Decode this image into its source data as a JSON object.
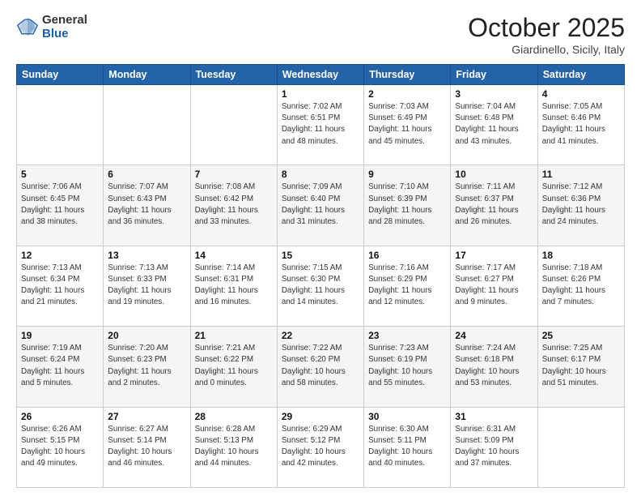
{
  "header": {
    "logo_general": "General",
    "logo_blue": "Blue",
    "month": "October 2025",
    "location": "Giardinello, Sicily, Italy"
  },
  "days_of_week": [
    "Sunday",
    "Monday",
    "Tuesday",
    "Wednesday",
    "Thursday",
    "Friday",
    "Saturday"
  ],
  "weeks": [
    [
      {
        "num": "",
        "info": ""
      },
      {
        "num": "",
        "info": ""
      },
      {
        "num": "",
        "info": ""
      },
      {
        "num": "1",
        "info": "Sunrise: 7:02 AM\nSunset: 6:51 PM\nDaylight: 11 hours\nand 48 minutes."
      },
      {
        "num": "2",
        "info": "Sunrise: 7:03 AM\nSunset: 6:49 PM\nDaylight: 11 hours\nand 45 minutes."
      },
      {
        "num": "3",
        "info": "Sunrise: 7:04 AM\nSunset: 6:48 PM\nDaylight: 11 hours\nand 43 minutes."
      },
      {
        "num": "4",
        "info": "Sunrise: 7:05 AM\nSunset: 6:46 PM\nDaylight: 11 hours\nand 41 minutes."
      }
    ],
    [
      {
        "num": "5",
        "info": "Sunrise: 7:06 AM\nSunset: 6:45 PM\nDaylight: 11 hours\nand 38 minutes."
      },
      {
        "num": "6",
        "info": "Sunrise: 7:07 AM\nSunset: 6:43 PM\nDaylight: 11 hours\nand 36 minutes."
      },
      {
        "num": "7",
        "info": "Sunrise: 7:08 AM\nSunset: 6:42 PM\nDaylight: 11 hours\nand 33 minutes."
      },
      {
        "num": "8",
        "info": "Sunrise: 7:09 AM\nSunset: 6:40 PM\nDaylight: 11 hours\nand 31 minutes."
      },
      {
        "num": "9",
        "info": "Sunrise: 7:10 AM\nSunset: 6:39 PM\nDaylight: 11 hours\nand 28 minutes."
      },
      {
        "num": "10",
        "info": "Sunrise: 7:11 AM\nSunset: 6:37 PM\nDaylight: 11 hours\nand 26 minutes."
      },
      {
        "num": "11",
        "info": "Sunrise: 7:12 AM\nSunset: 6:36 PM\nDaylight: 11 hours\nand 24 minutes."
      }
    ],
    [
      {
        "num": "12",
        "info": "Sunrise: 7:13 AM\nSunset: 6:34 PM\nDaylight: 11 hours\nand 21 minutes."
      },
      {
        "num": "13",
        "info": "Sunrise: 7:13 AM\nSunset: 6:33 PM\nDaylight: 11 hours\nand 19 minutes."
      },
      {
        "num": "14",
        "info": "Sunrise: 7:14 AM\nSunset: 6:31 PM\nDaylight: 11 hours\nand 16 minutes."
      },
      {
        "num": "15",
        "info": "Sunrise: 7:15 AM\nSunset: 6:30 PM\nDaylight: 11 hours\nand 14 minutes."
      },
      {
        "num": "16",
        "info": "Sunrise: 7:16 AM\nSunset: 6:29 PM\nDaylight: 11 hours\nand 12 minutes."
      },
      {
        "num": "17",
        "info": "Sunrise: 7:17 AM\nSunset: 6:27 PM\nDaylight: 11 hours\nand 9 minutes."
      },
      {
        "num": "18",
        "info": "Sunrise: 7:18 AM\nSunset: 6:26 PM\nDaylight: 11 hours\nand 7 minutes."
      }
    ],
    [
      {
        "num": "19",
        "info": "Sunrise: 7:19 AM\nSunset: 6:24 PM\nDaylight: 11 hours\nand 5 minutes."
      },
      {
        "num": "20",
        "info": "Sunrise: 7:20 AM\nSunset: 6:23 PM\nDaylight: 11 hours\nand 2 minutes."
      },
      {
        "num": "21",
        "info": "Sunrise: 7:21 AM\nSunset: 6:22 PM\nDaylight: 11 hours\nand 0 minutes."
      },
      {
        "num": "22",
        "info": "Sunrise: 7:22 AM\nSunset: 6:20 PM\nDaylight: 10 hours\nand 58 minutes."
      },
      {
        "num": "23",
        "info": "Sunrise: 7:23 AM\nSunset: 6:19 PM\nDaylight: 10 hours\nand 55 minutes."
      },
      {
        "num": "24",
        "info": "Sunrise: 7:24 AM\nSunset: 6:18 PM\nDaylight: 10 hours\nand 53 minutes."
      },
      {
        "num": "25",
        "info": "Sunrise: 7:25 AM\nSunset: 6:17 PM\nDaylight: 10 hours\nand 51 minutes."
      }
    ],
    [
      {
        "num": "26",
        "info": "Sunrise: 6:26 AM\nSunset: 5:15 PM\nDaylight: 10 hours\nand 49 minutes."
      },
      {
        "num": "27",
        "info": "Sunrise: 6:27 AM\nSunset: 5:14 PM\nDaylight: 10 hours\nand 46 minutes."
      },
      {
        "num": "28",
        "info": "Sunrise: 6:28 AM\nSunset: 5:13 PM\nDaylight: 10 hours\nand 44 minutes."
      },
      {
        "num": "29",
        "info": "Sunrise: 6:29 AM\nSunset: 5:12 PM\nDaylight: 10 hours\nand 42 minutes."
      },
      {
        "num": "30",
        "info": "Sunrise: 6:30 AM\nSunset: 5:11 PM\nDaylight: 10 hours\nand 40 minutes."
      },
      {
        "num": "31",
        "info": "Sunrise: 6:31 AM\nSunset: 5:09 PM\nDaylight: 10 hours\nand 37 minutes."
      },
      {
        "num": "",
        "info": ""
      }
    ]
  ]
}
